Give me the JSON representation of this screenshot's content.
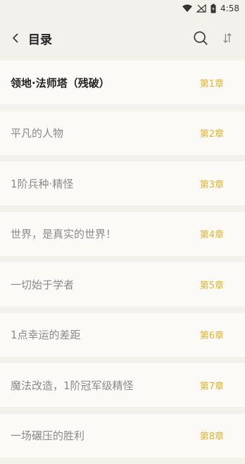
{
  "status": {
    "time": "4:58"
  },
  "header": {
    "title": "目录"
  },
  "chapters": [
    {
      "title": "领地·法师塔（残破）",
      "chapter": "第1章"
    },
    {
      "title": "平凡的人物",
      "chapter": "第2章"
    },
    {
      "title": "1阶兵种·精怪",
      "chapter": "第3章"
    },
    {
      "title": "世界，是真实的世界！",
      "chapter": "第4章"
    },
    {
      "title": "一切始于学者",
      "chapter": "第5章"
    },
    {
      "title": "1点幸运的差距",
      "chapter": "第6章"
    },
    {
      "title": "魔法改造，1阶冠军级精怪",
      "chapter": "第7章"
    },
    {
      "title": "一场碾压的胜利",
      "chapter": "第8章"
    }
  ],
  "colors": {
    "accent": "#e3b431",
    "background": "#f2f1ec",
    "row": "#fbfaf6"
  }
}
